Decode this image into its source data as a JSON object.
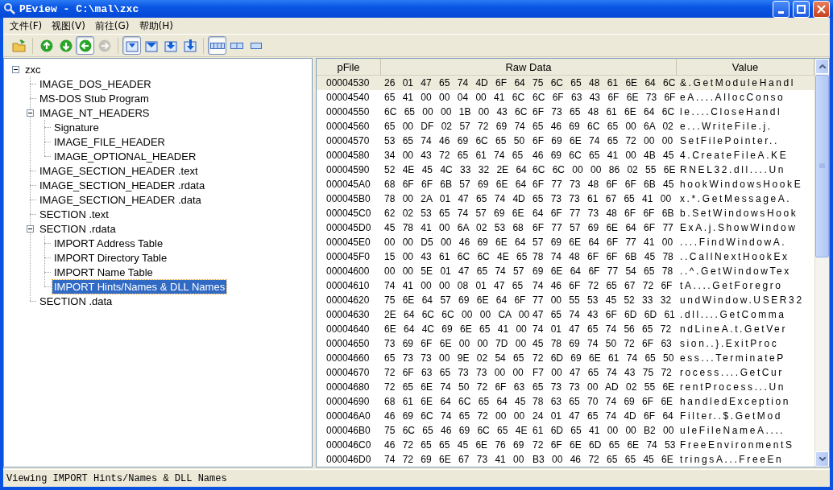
{
  "window": {
    "title": "PEview - C:\\mal\\zxc"
  },
  "menu": [
    "文件(F)",
    "视图(V)",
    "前往(G)",
    "帮助(H)"
  ],
  "toolbar": [
    {
      "kind": "open",
      "pressed": false,
      "disabled": false
    },
    {
      "kind": "up",
      "pressed": false,
      "disabled": false
    },
    {
      "kind": "down",
      "pressed": false,
      "disabled": false
    },
    {
      "kind": "back",
      "pressed": true,
      "disabled": false
    },
    {
      "kind": "forward",
      "pressed": false,
      "disabled": true
    },
    {
      "kind": "tray-down",
      "pressed": true,
      "disabled": false
    },
    {
      "kind": "tray",
      "pressed": false,
      "disabled": false
    },
    {
      "kind": "tray-arrow",
      "pressed": false,
      "disabled": false
    },
    {
      "kind": "tray-arrow-tall",
      "pressed": false,
      "disabled": false
    },
    {
      "kind": "view-bytes",
      "pressed": true,
      "disabled": false
    },
    {
      "kind": "view-words",
      "pressed": false,
      "disabled": false
    },
    {
      "kind": "view-dwords",
      "pressed": false,
      "disabled": false
    }
  ],
  "tree": [
    {
      "label": "zxc",
      "expanded": true,
      "selected": false,
      "children": [
        {
          "label": "IMAGE_DOS_HEADER",
          "selected": false
        },
        {
          "label": "MS-DOS Stub Program",
          "selected": false
        },
        {
          "label": "IMAGE_NT_HEADERS",
          "expanded": true,
          "selected": false,
          "children": [
            {
              "label": "Signature",
              "selected": false
            },
            {
              "label": "IMAGE_FILE_HEADER",
              "selected": false
            },
            {
              "label": "IMAGE_OPTIONAL_HEADER",
              "selected": false
            }
          ]
        },
        {
          "label": "IMAGE_SECTION_HEADER .text",
          "selected": false
        },
        {
          "label": "IMAGE_SECTION_HEADER .rdata",
          "selected": false
        },
        {
          "label": "IMAGE_SECTION_HEADER .data",
          "selected": false
        },
        {
          "label": "SECTION .text",
          "selected": false
        },
        {
          "label": "SECTION .rdata",
          "expanded": true,
          "selected": false,
          "children": [
            {
              "label": "IMPORT Address Table",
              "selected": false
            },
            {
              "label": "IMPORT Directory Table",
              "selected": false
            },
            {
              "label": "IMPORT Name Table",
              "selected": false
            },
            {
              "label": "IMPORT Hints/Names & DLL Names",
              "selected": true
            }
          ]
        },
        {
          "label": "SECTION .data",
          "selected": false
        }
      ]
    }
  ],
  "table": {
    "columns": [
      "pFile",
      "Raw Data",
      "Value"
    ],
    "rows": [
      {
        "pfile": "00004530",
        "raw_1": "26 01 47 65 74 4D 6F 64",
        "raw_2": "75 6C 65 48 61 6E 64 6C",
        "value": "&.GetModuleHandl",
        "selected": true
      },
      {
        "pfile": "00004540",
        "raw_1": "65 41 00 00 04 00 41 6C",
        "raw_2": "6C 6F 63 43 6F 6E 73 6F",
        "value": "eA....AllocConso",
        "selected": false
      },
      {
        "pfile": "00004550",
        "raw_1": "6C 65 00 00 1B 00 43 6C",
        "raw_2": "6F 73 65 48 61 6E 64 6C",
        "value": "le....CloseHandl",
        "selected": false
      },
      {
        "pfile": "00004560",
        "raw_1": "65 00 DF 02 57 72 69 74",
        "raw_2": "65 46 69 6C 65 00 6A 02",
        "value": "e...WriteFile.j.",
        "selected": false
      },
      {
        "pfile": "00004570",
        "raw_1": "53 65 74 46 69 6C 65 50",
        "raw_2": "6F 69 6E 74 65 72 00 00",
        "value": "SetFilePointer..",
        "selected": false
      },
      {
        "pfile": "00004580",
        "raw_1": "34 00 43 72 65 61 74 65",
        "raw_2": "46 69 6C 65 41 00 4B 45",
        "value": "4.CreateFileA.KE",
        "selected": false
      },
      {
        "pfile": "00004590",
        "raw_1": "52 4E 45 4C 33 32 2E 64",
        "raw_2": "6C 6C 00 00 86 02 55 6E",
        "value": "RNEL32.dll....Un",
        "selected": false
      },
      {
        "pfile": "000045A0",
        "raw_1": "68 6F 6F 6B 57 69 6E 64",
        "raw_2": "6F 77 73 48 6F 6F 6B 45",
        "value": "hookWindowsHookE",
        "selected": false
      },
      {
        "pfile": "000045B0",
        "raw_1": "78 00 2A 01 47 65 74 4D",
        "raw_2": "65 73 73 61 67 65 41 00",
        "value": "x.*.GetMessageA.",
        "selected": false
      },
      {
        "pfile": "000045C0",
        "raw_1": "62 02 53 65 74 57 69 6E",
        "raw_2": "64 6F 77 73 48 6F 6F 6B",
        "value": "b.SetWindowsHook",
        "selected": false
      },
      {
        "pfile": "000045D0",
        "raw_1": "45 78 41 00 6A 02 53 68",
        "raw_2": "6F 77 57 69 6E 64 6F 77",
        "value": "ExA.j.ShowWindow",
        "selected": false
      },
      {
        "pfile": "000045E0",
        "raw_1": "00 00 D5 00 46 69 6E 64",
        "raw_2": "57 69 6E 64 6F 77 41 00",
        "value": "....FindWindowA.",
        "selected": false
      },
      {
        "pfile": "000045F0",
        "raw_1": "15 00 43 61 6C 6C 4E 65",
        "raw_2": "78 74 48 6F 6F 6B 45 78",
        "value": "..CallNextHookEx",
        "selected": false
      },
      {
        "pfile": "00004600",
        "raw_1": "00 00 5E 01 47 65 74 57",
        "raw_2": "69 6E 64 6F 77 54 65 78",
        "value": "..^.GetWindowTex",
        "selected": false
      },
      {
        "pfile": "00004610",
        "raw_1": "74 41 00 00 08 01 47 65",
        "raw_2": "74 46 6F 72 65 67 72 6F",
        "value": "tA....GetForegro",
        "selected": false
      },
      {
        "pfile": "00004620",
        "raw_1": "75 6E 64 57 69 6E 64 6F",
        "raw_2": "77 00 55 53 45 52 33 32",
        "value": "undWindow.USER32",
        "selected": false
      },
      {
        "pfile": "00004630",
        "raw_1": "2E 64 6C 6C 00 00 CA 00",
        "raw_2": "47 65 74 43 6F 6D 6D 61",
        "value": ".dll....GetComma",
        "selected": false
      },
      {
        "pfile": "00004640",
        "raw_1": "6E 64 4C 69 6E 65 41 00",
        "raw_2": "74 01 47 65 74 56 65 72",
        "value": "ndLineA.t.GetVer",
        "selected": false
      },
      {
        "pfile": "00004650",
        "raw_1": "73 69 6F 6E 00 00 7D 00",
        "raw_2": "45 78 69 74 50 72 6F 63",
        "value": "sion..}.ExitProc",
        "selected": false
      },
      {
        "pfile": "00004660",
        "raw_1": "65 73 73 00 9E 02 54 65",
        "raw_2": "72 6D 69 6E 61 74 65 50",
        "value": "ess...TerminateP",
        "selected": false
      },
      {
        "pfile": "00004670",
        "raw_1": "72 6F 63 65 73 73 00 00",
        "raw_2": "F7 00 47 65 74 43 75 72",
        "value": "rocess....GetCur",
        "selected": false
      },
      {
        "pfile": "00004680",
        "raw_1": "72 65 6E 74 50 72 6F 63",
        "raw_2": "65 73 73 00 AD 02 55 6E",
        "value": "rentProcess...Un",
        "selected": false
      },
      {
        "pfile": "00004690",
        "raw_1": "68 61 6E 64 6C 65 64 45",
        "raw_2": "78 63 65 70 74 69 6F 6E",
        "value": "handledException",
        "selected": false
      },
      {
        "pfile": "000046A0",
        "raw_1": "46 69 6C 74 65 72 00 00",
        "raw_2": "24 01 47 65 74 4D 6F 64",
        "value": "Filter..$.GetMod",
        "selected": false
      },
      {
        "pfile": "000046B0",
        "raw_1": "75 6C 65 46 69 6C 65 4E",
        "raw_2": "61 6D 65 41 00 00 B2 00",
        "value": "uleFileNameA....",
        "selected": false
      },
      {
        "pfile": "000046C0",
        "raw_1": "46 72 65 65 45 6E 76 69",
        "raw_2": "72 6F 6E 6D 65 6E 74 53",
        "value": "FreeEnvironmentS",
        "selected": false
      },
      {
        "pfile": "000046D0",
        "raw_1": "74 72 69 6E 67 73 41 00",
        "raw_2": "B3 00 46 72 65 65 45 6E",
        "value": "tringsA...FreeEn",
        "selected": false
      }
    ]
  },
  "status_bar": "Viewing IMPORT Hints/Names & DLL Names"
}
